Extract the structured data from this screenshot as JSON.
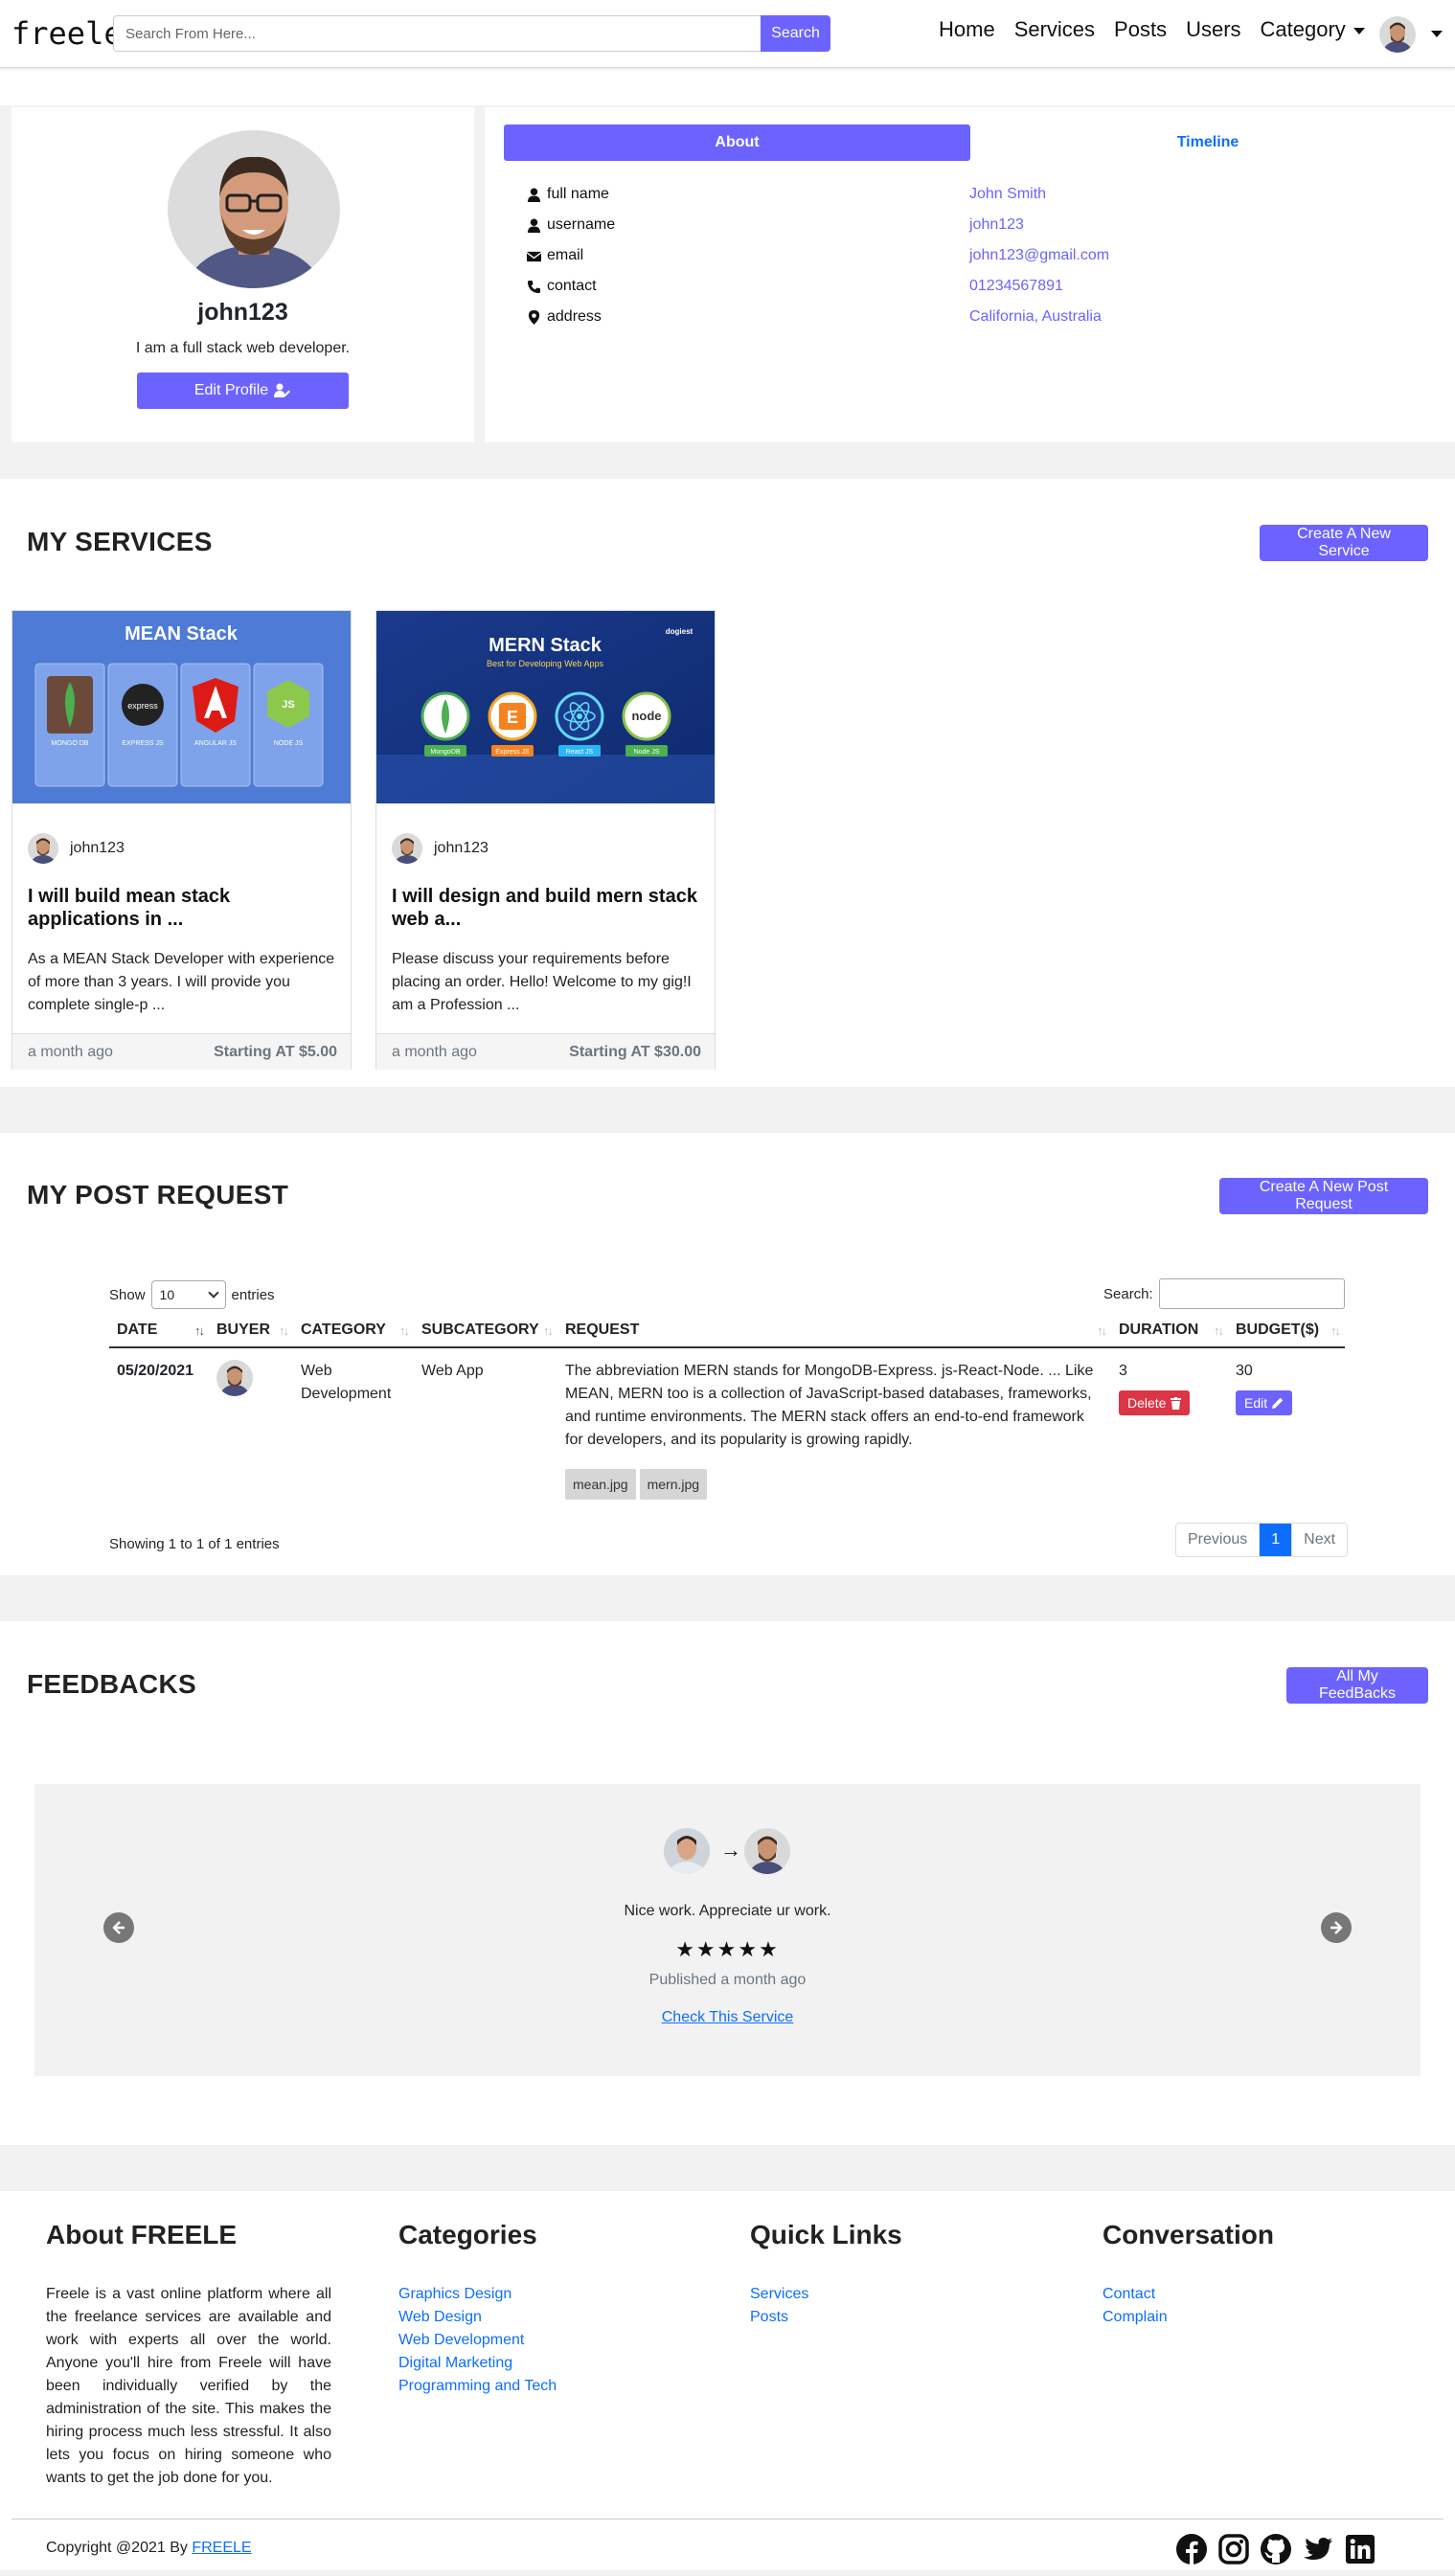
{
  "navbar": {
    "brand": "freele",
    "search_placeholder": "Search From Here...",
    "search_button": "Search",
    "links": [
      "Home",
      "Services",
      "Posts",
      "Users"
    ],
    "category_label": "Category"
  },
  "profile": {
    "username": "john123",
    "bio": "I am a full stack web developer.",
    "edit_button": "Edit Profile",
    "tabs": {
      "about": "About",
      "timeline": "Timeline"
    },
    "info": [
      {
        "icon": "user-icon",
        "label": "full name",
        "value": "John Smith"
      },
      {
        "icon": "user-icon",
        "label": "username",
        "value": "john123"
      },
      {
        "icon": "envelope-icon",
        "label": "email",
        "value": "john123@gmail.com"
      },
      {
        "icon": "phone-icon",
        "label": "contact",
        "value": "01234567891"
      },
      {
        "icon": "map-marker-icon",
        "label": "address",
        "value": "California, Australia"
      }
    ]
  },
  "services": {
    "title": "MY SERVICES",
    "create_button": "Create A New Service",
    "cards": [
      {
        "image_title": "MEAN Stack",
        "image_items": [
          "MONGO DB",
          "EXPRESS JS",
          "ANGULAR JS",
          "NODE JS"
        ],
        "seller": "john123",
        "title": "I will build mean stack applications in ...",
        "description": "As a MEAN Stack Developer with experience of more than 3 years. I will provide you complete single-p ...",
        "time": "a month ago",
        "price": "Starting AT $5.00"
      },
      {
        "image_title": "MERN Stack",
        "image_subtitle": "Best for Developing Web Apps",
        "image_items": [
          "MongoDB",
          "Express JS",
          "React JS",
          "Node JS"
        ],
        "seller": "john123",
        "title": "I will design and build mern stack web a...",
        "description": "Please discuss your requirements before placing an order. Hello! Welcome to my gig!I am a Profession ...",
        "time": "a month ago",
        "price": "Starting AT $30.00"
      }
    ]
  },
  "posts": {
    "title": "MY POST REQUEST",
    "create_button": "Create A New Post Request",
    "show_label": "Show",
    "entries_value": "10",
    "entries_label": "entries",
    "search_label": "Search:",
    "columns": [
      "DATE",
      "BUYER",
      "CATEGORY",
      "SUBCATEGORY",
      "REQUEST",
      "DURATION",
      "BUDGET($)"
    ],
    "rows": [
      {
        "date": "05/20/2021",
        "category": "Web Development",
        "subcategory": "Web App",
        "request": "The abbreviation MERN stands for MongoDB-Express. js-React-Node. ... Like MEAN, MERN too is a collection of JavaScript-based databases, frameworks, and runtime environments. The MERN stack offers an end-to-end framework for developers, and its popularity is growing rapidly.",
        "files": [
          "mean.jpg",
          "mern.jpg"
        ],
        "duration": "3",
        "budget": "30",
        "delete_label": "Delete",
        "edit_label": "Edit"
      }
    ],
    "info": "Showing 1 to 1 of 1 entries",
    "pagination": {
      "previous": "Previous",
      "current": "1",
      "next": "Next"
    }
  },
  "feedbacks": {
    "title": "FEEDBACKS",
    "all_button": "All My FeedBacks",
    "arrow": "→",
    "text": "Nice work. Appreciate ur work.",
    "stars": "★★★★★",
    "rating": 5,
    "published": "Published a month ago",
    "link": "Check This Service"
  },
  "footer": {
    "about_title": "About FREELE",
    "about_text": "Freele is a vast online platform where all the freelance services are available and work with experts all over the world. Anyone you'll hire from Freele will have been individually verified by the administration of the site. This makes the hiring process much less stressful. It also lets you focus on hiring someone who wants to get the job done for you.",
    "categories_title": "Categories",
    "categories": [
      "Graphics Design",
      "Web Design",
      "Web Development",
      "Digital Marketing",
      "Programming and Tech"
    ],
    "quick_title": "Quick Links",
    "quick_links": [
      "Services",
      "Posts"
    ],
    "conversation_title": "Conversation",
    "conversation_links": [
      "Contact",
      "Complain"
    ],
    "copyright": "Copyright @2021 By",
    "copyright_link": "FREELE",
    "socials": [
      "facebook-icon",
      "instagram-icon",
      "github-icon",
      "twitter-icon",
      "linkedin-icon"
    ]
  },
  "colors": {
    "primary": "#6c63ff",
    "link": "#0d6efd",
    "danger": "#dc3545",
    "band": "#f2f2f2"
  }
}
